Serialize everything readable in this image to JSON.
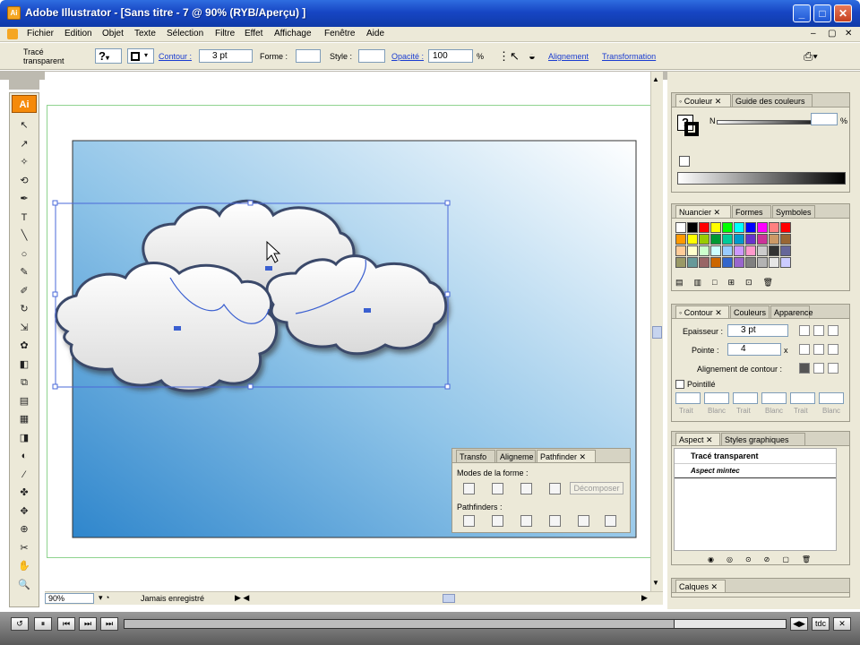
{
  "window": {
    "title": "Adobe Illustrator - [Sans titre - 7 @ 90% (RYB/Aperçu) ]",
    "min": "_",
    "max": "□",
    "close": "✕"
  },
  "menu": [
    "Fichier",
    "Edition",
    "Objet",
    "Texte",
    "Sélection",
    "Filtre",
    "Effet",
    "Affichage",
    "Fenêtre",
    "Aide"
  ],
  "menu_right": [
    "–",
    "▢",
    "✕"
  ],
  "control": {
    "trace_line1": "Tracé",
    "trace_line2": "transparent",
    "contour_label": "Contour :",
    "contour_value": "3 pt",
    "forme_label": "Forme :",
    "style_label": "Style :",
    "opacite_label": "Opacité :",
    "opacite_value": "100",
    "pct": "%",
    "alignement_link": "Alignement",
    "transformation_link": "Transformation"
  },
  "toolbox": {
    "logo": "Ai"
  },
  "tools": [
    "↖",
    "↗",
    "✧",
    "⟲",
    "✒",
    "T",
    "╲",
    "○",
    "✎",
    "✐",
    "↻",
    "⇲",
    "✿",
    "◧",
    "⧉",
    "▤",
    "▦",
    "◨",
    "◐",
    "⁄",
    "✤",
    "✥",
    "⊕",
    "✂",
    "✋",
    "🔍"
  ],
  "status": {
    "zoom": "90%",
    "saved": "Jamais enregistré"
  },
  "couleur_panel": {
    "tabs": [
      "Couleur",
      "Guide des couleurs"
    ],
    "n_label": "N",
    "pct": "%"
  },
  "nuancier_panel": {
    "tabs": [
      "Nuancier",
      "Formes",
      "Symboles"
    ],
    "swatches": [
      "#ffffff",
      "#000000",
      "#ff0000",
      "#ffff00",
      "#00ff00",
      "#00ffff",
      "#0000ff",
      "#ff00ff",
      "#ff8080",
      "#ff0000",
      "#ff9900",
      "#ffff00",
      "#99cc00",
      "#009933",
      "#00cc99",
      "#0099cc",
      "#6633cc",
      "#cc3399",
      "#cc9966",
      "#996633",
      "#ffcc99",
      "#ffffcc",
      "#ccffcc",
      "#ccffff",
      "#99ccff",
      "#cc99ff",
      "#ff99cc",
      "#cccccc",
      "#333333",
      "#666699",
      "#999966",
      "#669999",
      "#996666",
      "#cc6600",
      "#3366cc",
      "#9966cc",
      "#808080",
      "#b3b3b3",
      "#e6e6e6",
      "#ccccff"
    ]
  },
  "contour_panel": {
    "tabs": [
      "Contour",
      "Couleurs",
      "Apparence"
    ],
    "epaisseur_label": "Epaisseur :",
    "epaisseur_value": "3 pt",
    "pointe_label": "Pointe :",
    "pointe_value": "4",
    "x": "x",
    "alignement_label": "Alignement de contour :",
    "pointille_label": "Pointillé",
    "dash_labels": [
      "Trait",
      "Blanc",
      "Trait",
      "Blanc",
      "Trait",
      "Blanc"
    ]
  },
  "aspect_panel": {
    "tabs": [
      "Aspect",
      "Styles graphiques"
    ],
    "title": "Tracé transparent",
    "row": "Aspect mintec"
  },
  "calques_panel": {
    "tabs": [
      "Calques"
    ]
  },
  "pathfinder_panel": {
    "tabs": [
      "Transfo",
      "Aligneme",
      "Pathfinder"
    ],
    "modes_label": "Modes de la forme :",
    "decompose": "Décomposer",
    "pathfinders_label": "Pathfinders :"
  },
  "player": {
    "buttons": [
      "↺",
      "⏸",
      "⏮",
      "⏭",
      "⏭"
    ],
    "right": [
      "◀▶",
      "tdc",
      "✕"
    ]
  }
}
